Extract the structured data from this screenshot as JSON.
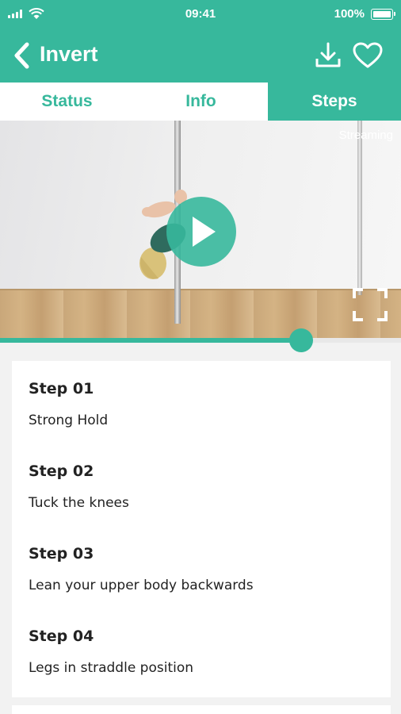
{
  "status_bar": {
    "time": "09:41",
    "battery": "100%"
  },
  "header": {
    "title": "Invert",
    "back_icon": "chevron-left-icon",
    "download_icon": "download-icon",
    "favorite_icon": "heart-icon"
  },
  "tabs": [
    {
      "label": "Status",
      "active": false
    },
    {
      "label": "Info",
      "active": false
    },
    {
      "label": "Steps",
      "active": true
    }
  ],
  "video": {
    "streaming_label": "Streaming",
    "play_icon": "play-icon",
    "fullscreen_icon": "fullscreen-icon",
    "progress_fraction": 0.75
  },
  "steps": [
    {
      "title": "Step 01",
      "text": "Strong Hold"
    },
    {
      "title": "Step 02",
      "text": "Tuck the knees"
    },
    {
      "title": "Step 03",
      "text": "Lean your upper body backwards"
    },
    {
      "title": "Step 04",
      "text": "Legs in straddle position"
    }
  ],
  "colors": {
    "accent": "#37b89c",
    "background": "#f2f2f2",
    "card": "#ffffff",
    "text": "#222222"
  }
}
